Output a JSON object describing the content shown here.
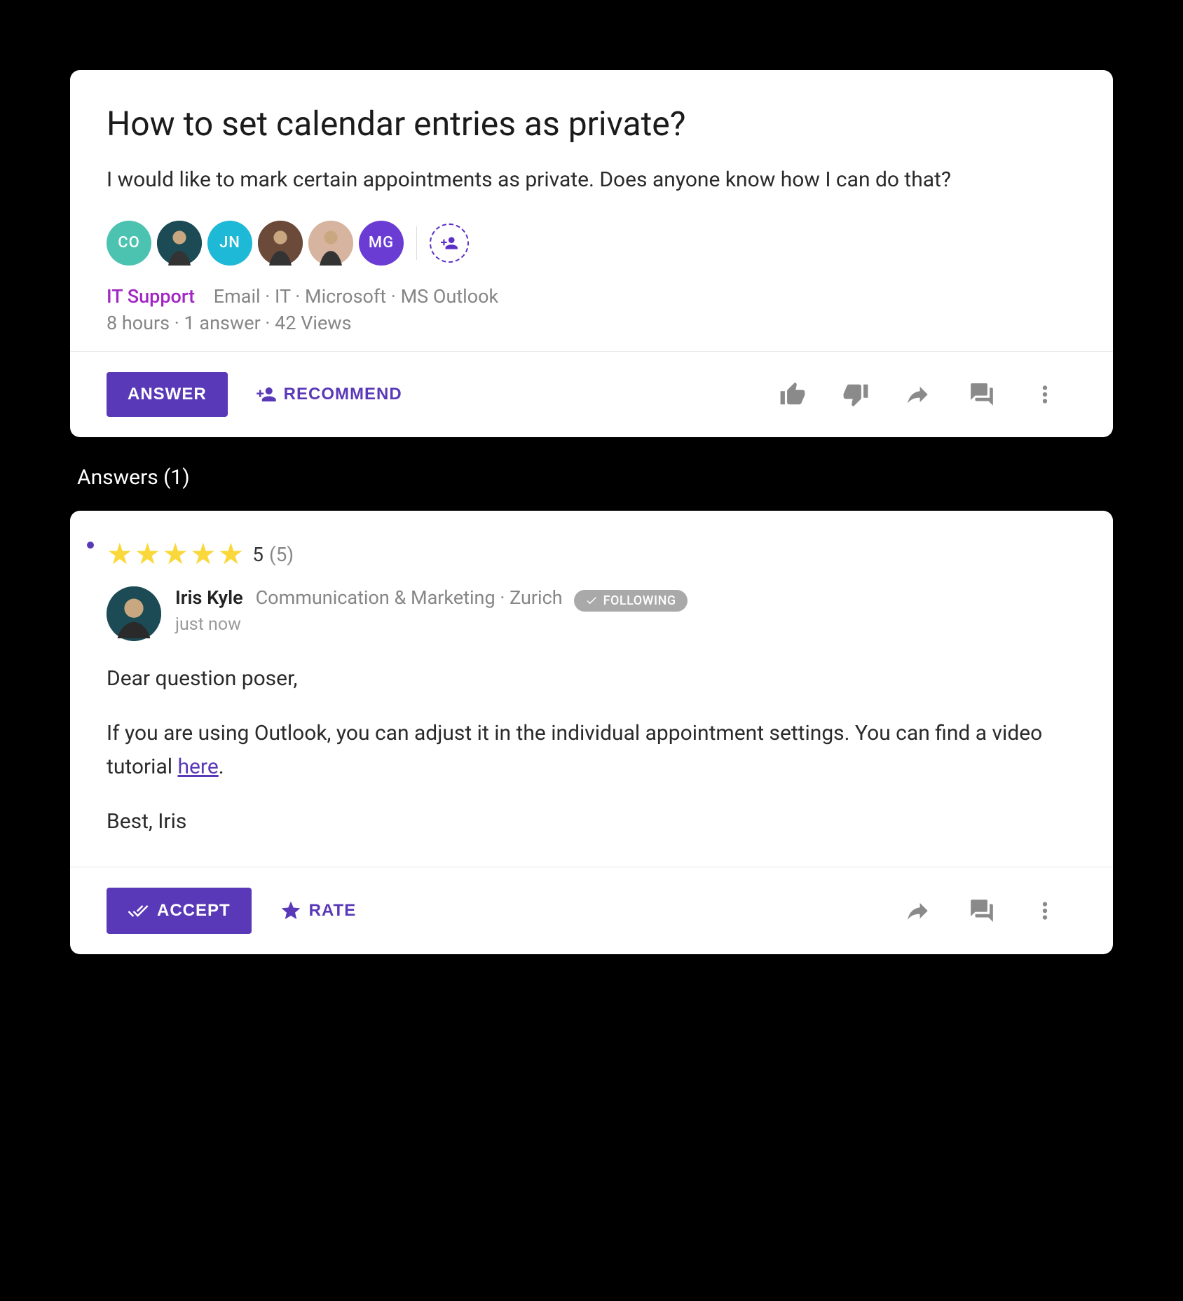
{
  "question": {
    "title": "How to set calendar entries as private?",
    "body": "I would like to mark certain appointments as private. Does anyone know how I can do that?",
    "avatars": [
      {
        "type": "initials",
        "text": "CO",
        "bg": "#4cc2b1"
      },
      {
        "type": "photo",
        "bg": "#1c4a55"
      },
      {
        "type": "initials",
        "text": "JN",
        "bg": "#1db9d6"
      },
      {
        "type": "photo",
        "bg": "#6b4a3a"
      },
      {
        "type": "photo",
        "bg": "#d7b49f"
      },
      {
        "type": "initials",
        "text": "MG",
        "bg": "#6a3cd4"
      }
    ],
    "category": "IT Support",
    "tags": "Email · IT · Microsoft · MS Outlook",
    "meta": "8 hours · 1 answer · 42 Views",
    "actions": {
      "answer": "ANSWER",
      "recommend": "RECOMMEND"
    }
  },
  "answers_header": "Answers (1)",
  "answer": {
    "rating": {
      "value": "5",
      "count": "(5)"
    },
    "author": {
      "name": "Iris Kyle",
      "dept": "Communication & Marketing · Zurich",
      "time": "just now",
      "following": "FOLLOWING"
    },
    "body": {
      "greeting": "Dear question poser,",
      "main_before": "If you are using Outlook, you can adjust it in the individual appointment settings. You can find a video tutorial ",
      "link": "here",
      "main_after": ".",
      "signoff": "Best, Iris"
    },
    "actions": {
      "accept": "ACCEPT",
      "rate": "RATE"
    }
  }
}
